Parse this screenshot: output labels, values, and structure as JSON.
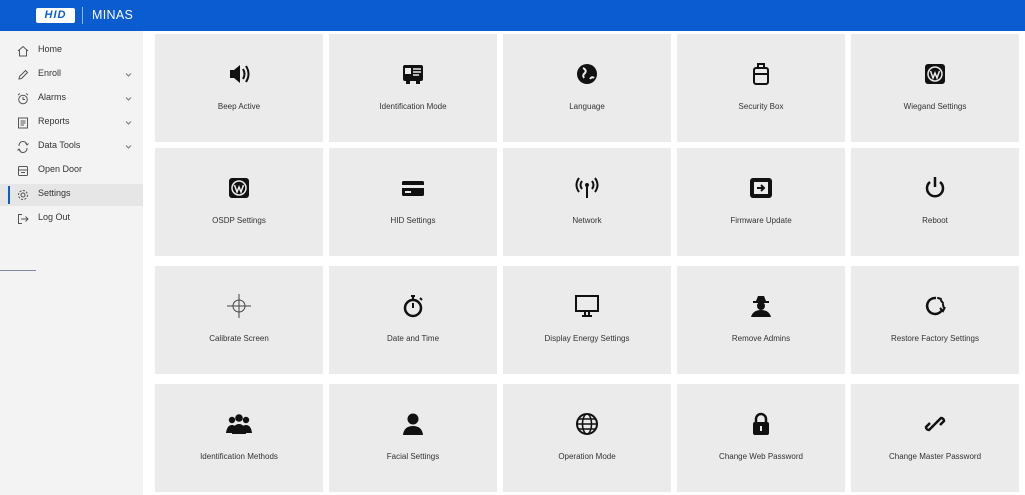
{
  "header": {
    "logo_text": "HID",
    "title": "MINAS",
    "brand_color": "#0b5bd1"
  },
  "sidebar": {
    "items": [
      {
        "label": "Home",
        "icon": "home-icon",
        "expandable": false,
        "active": false
      },
      {
        "label": "Enroll",
        "icon": "pencil-icon",
        "expandable": true,
        "active": false
      },
      {
        "label": "Alarms",
        "icon": "alarm-clock-icon",
        "expandable": true,
        "active": false
      },
      {
        "label": "Reports",
        "icon": "report-icon",
        "expandable": true,
        "active": false
      },
      {
        "label": "Data Tools",
        "icon": "sync-icon",
        "expandable": true,
        "active": false
      },
      {
        "label": "Open Door",
        "icon": "door-icon",
        "expandable": false,
        "active": false
      },
      {
        "label": "Settings",
        "icon": "gear-icon",
        "expandable": false,
        "active": true
      },
      {
        "label": "Log Out",
        "icon": "logout-icon",
        "expandable": false,
        "active": false
      }
    ]
  },
  "settings": {
    "tiles": [
      {
        "label": "Beep Active",
        "icon": "speaker-icon"
      },
      {
        "label": "Identification Mode",
        "icon": "id-card-icon"
      },
      {
        "label": "Language",
        "icon": "globe-icon"
      },
      {
        "label": "Security Box",
        "icon": "luggage-icon"
      },
      {
        "label": "Wiegand Settings",
        "icon": "wordpress-icon"
      },
      {
        "label": "OSDP Settings",
        "icon": "wordpress-icon"
      },
      {
        "label": "HID Settings",
        "icon": "credit-card-icon"
      },
      {
        "label": "Network",
        "icon": "antenna-icon"
      },
      {
        "label": "Firmware Update",
        "icon": "device-update-icon"
      },
      {
        "label": "Reboot",
        "icon": "power-icon"
      },
      {
        "label": "Calibrate Screen",
        "icon": "crosshair-icon"
      },
      {
        "label": "Date and Time",
        "icon": "stopwatch-icon"
      },
      {
        "label": "Display Energy Settings",
        "icon": "monitor-icon"
      },
      {
        "label": "Remove Admins",
        "icon": "spy-icon"
      },
      {
        "label": "Restore Factory Settings",
        "icon": "restore-icon"
      },
      {
        "label": "Identification Methods",
        "icon": "users-icon"
      },
      {
        "label": "Facial Settings",
        "icon": "user-icon"
      },
      {
        "label": "Operation Mode",
        "icon": "world-grid-icon"
      },
      {
        "label": "Change Web Password",
        "icon": "lock-icon"
      },
      {
        "label": "Change Master Password",
        "icon": "link-icon"
      }
    ]
  }
}
